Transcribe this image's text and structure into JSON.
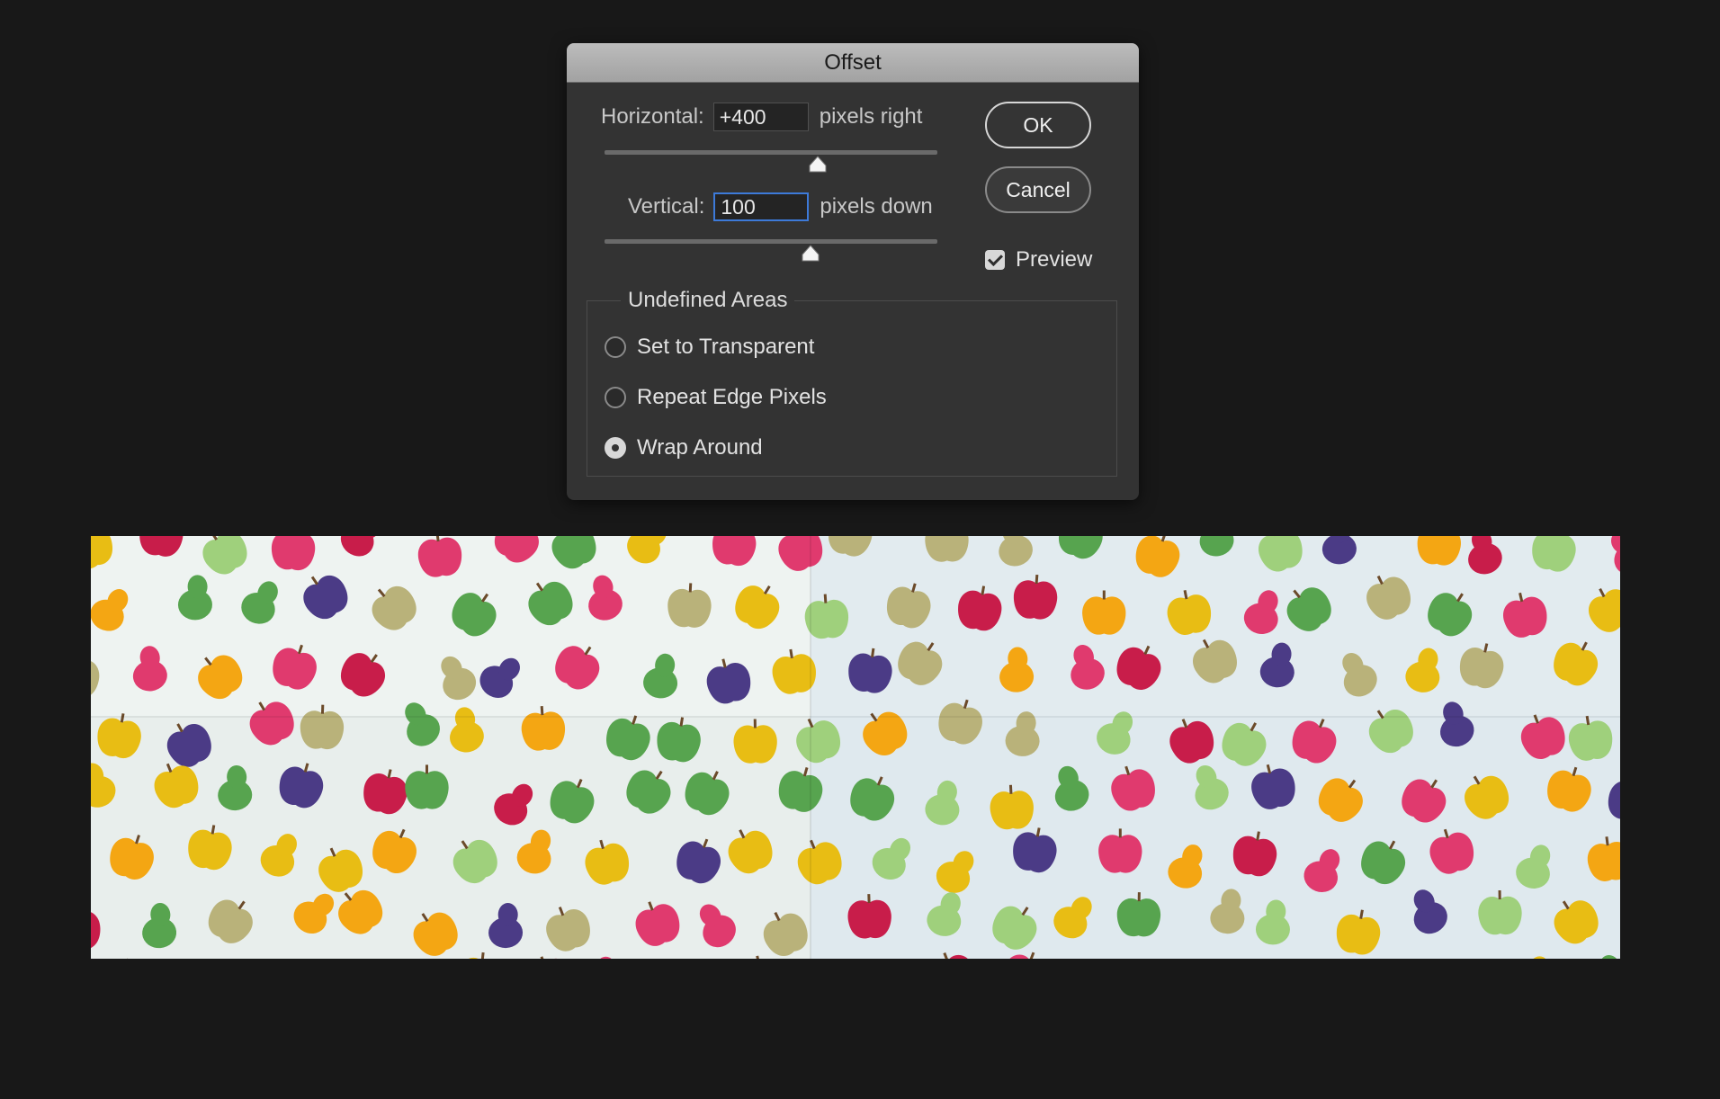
{
  "dialog": {
    "title": "Offset",
    "horizontal": {
      "label": "Horizontal:",
      "value": "+400",
      "unit": "pixels right",
      "slider_fraction": 0.64
    },
    "vertical": {
      "label": "Vertical:",
      "value": "100",
      "unit": "pixels down",
      "slider_fraction": 0.62
    },
    "ok_label": "OK",
    "cancel_label": "Cancel",
    "preview": {
      "label": "Preview",
      "checked": true
    },
    "undefined_areas": {
      "title": "Undefined Areas",
      "options": [
        {
          "label": "Set to Transparent",
          "selected": false
        },
        {
          "label": "Repeat Edge Pixels",
          "selected": false
        },
        {
          "label": "Wrap Around",
          "selected": true
        }
      ]
    }
  },
  "colors": {
    "fruit": [
      "#e8bd14",
      "#e03a6e",
      "#57a44f",
      "#b9b27a",
      "#4b3b86",
      "#9fd07c",
      "#f4a613",
      "#c81d4a"
    ]
  }
}
